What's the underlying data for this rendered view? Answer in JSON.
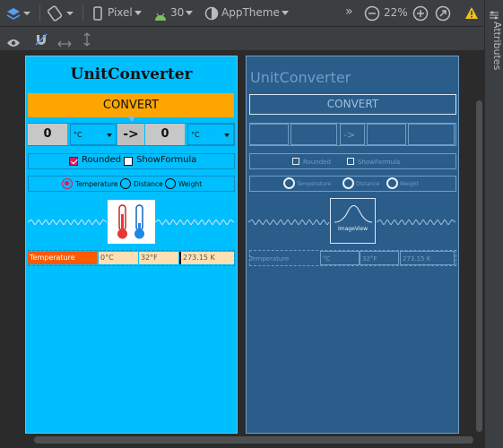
{
  "toolbar": {
    "device": "Pixel",
    "api_level": "30",
    "theme": "AppTheme",
    "zoom": "22%",
    "overflow": "»"
  },
  "sidebar": {
    "label": "Attributes"
  },
  "design": {
    "title": "UnitConverter",
    "convert_label": "CONVERT",
    "from_value": "0",
    "to_value": "0",
    "from_unit": "°C",
    "to_unit": "°C",
    "swap_label": "->",
    "rounded_label": "Rounded",
    "show_formula_label": "ShowFormula",
    "radio_temperature": "Temperature",
    "radio_distance": "Distance",
    "radio_weight": "Weight",
    "result_name": "Temperature",
    "result_c": "0°C",
    "result_f": "32°F",
    "result_k": "273.15 K"
  },
  "blueprint": {
    "title": "UnitConverter",
    "convert_label": "CONVERT",
    "swap_label": "->",
    "rounded_label": "Rounded",
    "show_formula_label": "ShowFormula",
    "radio_temperature": "Temperature",
    "radio_distance": "Distance",
    "radio_weight": "Weight",
    "image_label": "ImageView",
    "result_name": "Temperature",
    "result_c": "°C",
    "result_f": "32°F",
    "result_k": "273.15 K"
  },
  "colors": {
    "design_bg": "#00bfff",
    "convert_button": "#ffa500",
    "blueprint_bg": "#2a5d8a",
    "accent_pink": "#d81b60",
    "warning_yellow": "#f0c020"
  }
}
